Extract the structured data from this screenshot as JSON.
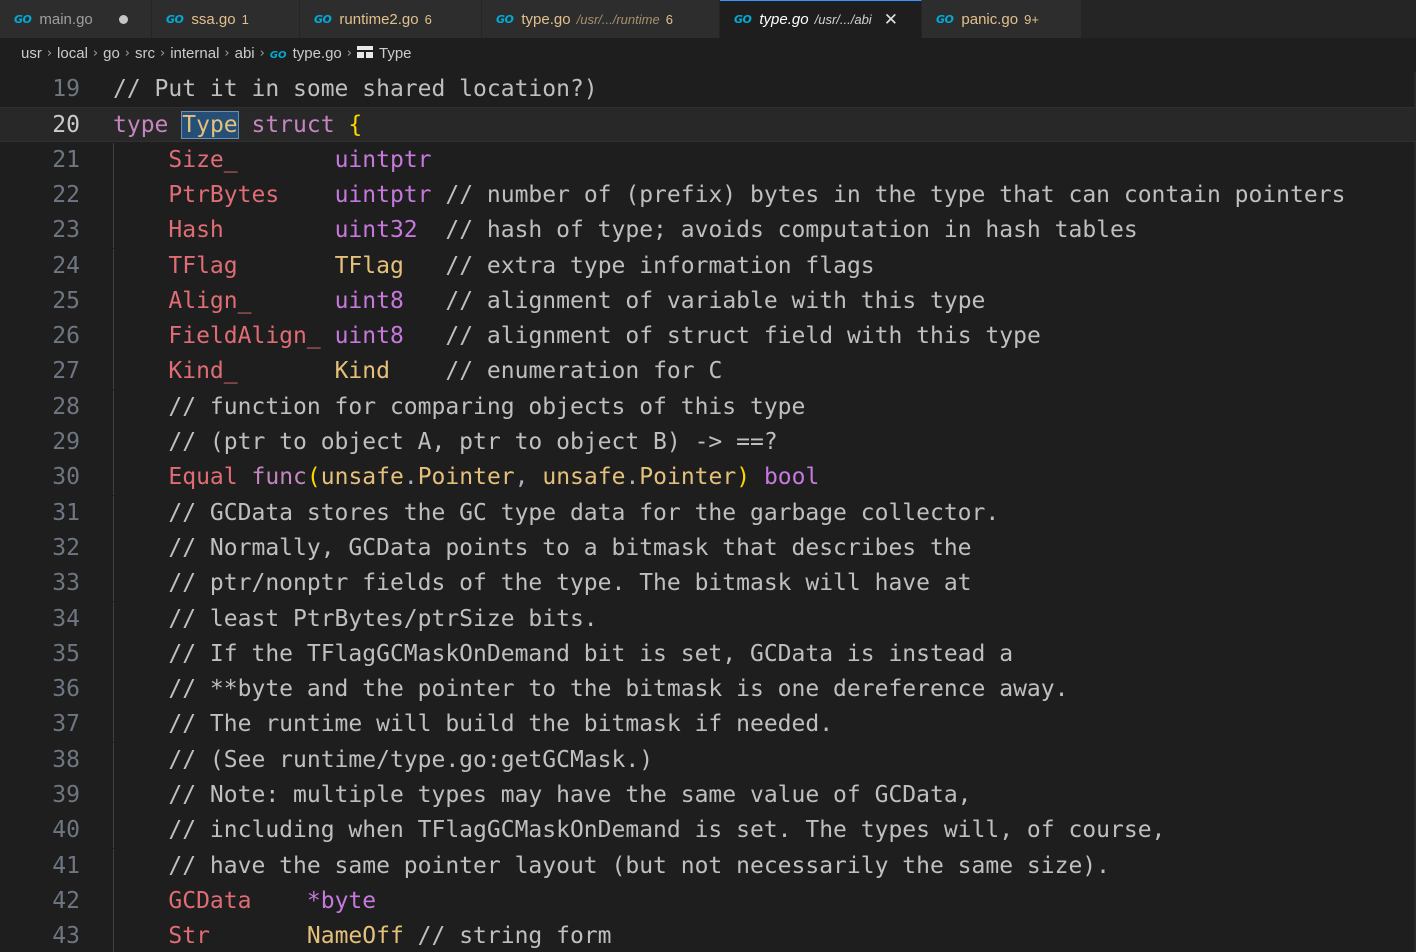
{
  "tabs": [
    {
      "name": "main.go",
      "badge": "",
      "desc": "",
      "state": "modified"
    },
    {
      "name": "ssa.go",
      "badge": "1",
      "desc": ""
    },
    {
      "name": "runtime2.go",
      "badge": "6",
      "desc": ""
    },
    {
      "name": "type.go",
      "badge": "6",
      "desc": "/usr/.../runtime"
    },
    {
      "name": "type.go",
      "badge": "",
      "desc": "/usr/.../abi",
      "active": true,
      "close": "✕"
    },
    {
      "name": "panic.go",
      "badge": "9+",
      "desc": ""
    }
  ],
  "go_icon_text": "GO",
  "breadcrumbs": [
    "usr",
    "local",
    "go",
    "src",
    "internal",
    "abi",
    "type.go",
    "Type"
  ],
  "colors": {
    "keyword": "#c586c0",
    "type": "#e5c07b",
    "builtin": "#c678dd",
    "field": "#e06c75",
    "comment": "#bfbfbf",
    "active_tab_border": "#3794ff"
  },
  "editor": {
    "current_line": 20,
    "lines": [
      {
        "n": "19",
        "segs": [
          [
            "cm",
            "// Put it in some shared location?)"
          ]
        ]
      },
      {
        "n": "20",
        "segs": [
          [
            "kw",
            "type "
          ],
          [
            "ty hl",
            "Type"
          ],
          [
            "kw",
            " struct "
          ],
          [
            "br",
            "{"
          ]
        ]
      },
      {
        "n": "21",
        "segs": [
          [
            "pu",
            "    "
          ],
          [
            "fld",
            "Size_"
          ],
          [
            "pu",
            "       "
          ],
          [
            "bt",
            "uintptr"
          ]
        ]
      },
      {
        "n": "22",
        "segs": [
          [
            "pu",
            "    "
          ],
          [
            "fld",
            "PtrBytes"
          ],
          [
            "pu",
            "    "
          ],
          [
            "bt",
            "uintptr"
          ],
          [
            "cm",
            " // number of (prefix) bytes in the type that can contain pointers"
          ]
        ]
      },
      {
        "n": "23",
        "segs": [
          [
            "pu",
            "    "
          ],
          [
            "fld",
            "Hash"
          ],
          [
            "pu",
            "        "
          ],
          [
            "bt",
            "uint32"
          ],
          [
            "cm",
            "  // hash of type; avoids computation in hash tables"
          ]
        ]
      },
      {
        "n": "24",
        "segs": [
          [
            "pu",
            "    "
          ],
          [
            "fld",
            "TFlag"
          ],
          [
            "pu",
            "       "
          ],
          [
            "ty",
            "TFlag"
          ],
          [
            "cm",
            "   // extra type information flags"
          ]
        ]
      },
      {
        "n": "25",
        "segs": [
          [
            "pu",
            "    "
          ],
          [
            "fld",
            "Align_"
          ],
          [
            "pu",
            "      "
          ],
          [
            "bt",
            "uint8"
          ],
          [
            "cm",
            "   // alignment of variable with this type"
          ]
        ]
      },
      {
        "n": "26",
        "segs": [
          [
            "pu",
            "    "
          ],
          [
            "fld",
            "FieldAlign_"
          ],
          [
            "pu",
            " "
          ],
          [
            "bt",
            "uint8"
          ],
          [
            "cm",
            "   // alignment of struct field with this type"
          ]
        ]
      },
      {
        "n": "27",
        "segs": [
          [
            "pu",
            "    "
          ],
          [
            "fld",
            "Kind_"
          ],
          [
            "pu",
            "       "
          ],
          [
            "ty",
            "Kind"
          ],
          [
            "cm",
            "    // enumeration for C"
          ]
        ]
      },
      {
        "n": "28",
        "segs": [
          [
            "cm",
            "    // function for comparing objects of this type"
          ]
        ]
      },
      {
        "n": "29",
        "segs": [
          [
            "cm",
            "    // (ptr to object A, ptr to object B) -> ==?"
          ]
        ]
      },
      {
        "n": "30",
        "segs": [
          [
            "pu",
            "    "
          ],
          [
            "fld",
            "Equal"
          ],
          [
            "pu",
            " "
          ],
          [
            "kw",
            "func"
          ],
          [
            "br",
            "("
          ],
          [
            "ty",
            "unsafe"
          ],
          [
            "pu",
            "."
          ],
          [
            "ty",
            "Pointer"
          ],
          [
            "pu",
            ", "
          ],
          [
            "ty",
            "unsafe"
          ],
          [
            "pu",
            "."
          ],
          [
            "ty",
            "Pointer"
          ],
          [
            "br",
            ")"
          ],
          [
            "pu",
            " "
          ],
          [
            "bt",
            "bool"
          ]
        ]
      },
      {
        "n": "31",
        "segs": [
          [
            "cm",
            "    // GCData stores the GC type data for the garbage collector."
          ]
        ]
      },
      {
        "n": "32",
        "segs": [
          [
            "cm",
            "    // Normally, GCData points to a bitmask that describes the"
          ]
        ]
      },
      {
        "n": "33",
        "segs": [
          [
            "cm",
            "    // ptr/nonptr fields of the type. The bitmask will have at"
          ]
        ]
      },
      {
        "n": "34",
        "segs": [
          [
            "cm",
            "    // least PtrBytes/ptrSize bits."
          ]
        ]
      },
      {
        "n": "35",
        "segs": [
          [
            "cm",
            "    // If the TFlagGCMaskOnDemand bit is set, GCData is instead a"
          ]
        ]
      },
      {
        "n": "36",
        "segs": [
          [
            "cm",
            "    // **byte and the pointer to the bitmask is one dereference away."
          ]
        ]
      },
      {
        "n": "37",
        "segs": [
          [
            "cm",
            "    // The runtime will build the bitmask if needed."
          ]
        ]
      },
      {
        "n": "38",
        "segs": [
          [
            "cm",
            "    // (See runtime/type.go:getGCMask.)"
          ]
        ]
      },
      {
        "n": "39",
        "segs": [
          [
            "cm",
            "    // Note: multiple types may have the same value of GCData,"
          ]
        ]
      },
      {
        "n": "40",
        "segs": [
          [
            "cm",
            "    // including when TFlagGCMaskOnDemand is set. The types will, of course,"
          ]
        ]
      },
      {
        "n": "41",
        "segs": [
          [
            "cm",
            "    // have the same pointer layout (but not necessarily the same size)."
          ]
        ]
      },
      {
        "n": "42",
        "segs": [
          [
            "pu",
            "    "
          ],
          [
            "fld",
            "GCData"
          ],
          [
            "pu",
            "    "
          ],
          [
            "bt",
            "*byte"
          ]
        ]
      },
      {
        "n": "43",
        "segs": [
          [
            "pu",
            "    "
          ],
          [
            "fld",
            "Str"
          ],
          [
            "pu",
            "       "
          ],
          [
            "ty",
            "NameOff"
          ],
          [
            "cm",
            " // string form"
          ]
        ]
      }
    ]
  }
}
